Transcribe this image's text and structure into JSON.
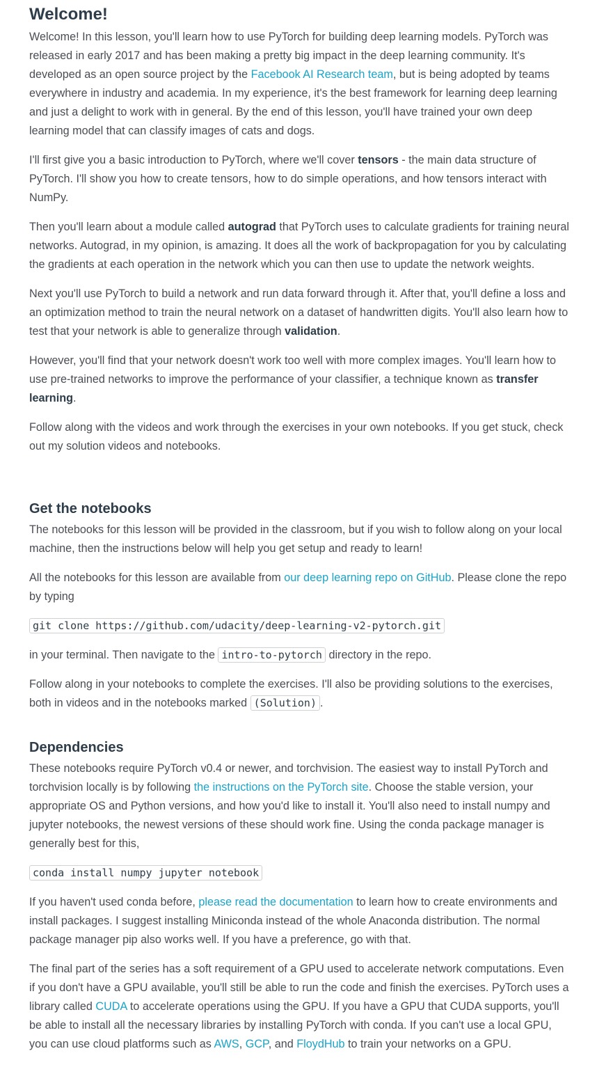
{
  "welcome": {
    "title": "Welcome!",
    "p1": {
      "a": "Welcome! In this lesson, you'll learn how to use PyTorch for building deep learning models. PyTorch was released in early 2017 and has been making a pretty big impact in the deep learning community. It's developed as an open source project by the ",
      "link": "Facebook AI Research team",
      "b": ", but is being adopted by teams everywhere in industry and academia. In my experience, it's the best framework for learning deep learning and just a delight to work with in general. By the end of this lesson, you'll have trained your own deep learning model that can classify images of cats and dogs."
    },
    "p2": {
      "a": "I'll first give you a basic introduction to PyTorch, where we'll cover ",
      "bold": "tensors",
      "b": " - the main data structure of PyTorch. I'll show you how to create tensors, how to do simple operations, and how tensors interact with NumPy."
    },
    "p3": {
      "a": "Then you'll learn about a module called ",
      "bold": "autograd",
      "b": " that PyTorch uses to calculate gradients for training neural networks. Autograd, in my opinion, is amazing. It does all the work of backpropagation for you by calculating the gradients at each operation in the network which you can then use to update the network weights."
    },
    "p4": {
      "a": "Next you'll use PyTorch to build a network and run data forward through it. After that, you'll define a loss and an optimization method to train the neural network on a dataset of handwritten digits. You'll also learn how to test that your network is able to generalize through ",
      "bold": "validation",
      "b": "."
    },
    "p5": {
      "a": "However, you'll find that your network doesn't work too well with more complex images. You'll learn how to use pre-trained networks to improve the performance of your classifier, a technique known as ",
      "bold": "transfer learning",
      "b": "."
    },
    "p6": "Follow along with the videos and work through the exercises in your own notebooks. If you get stuck, check out my solution videos and notebooks."
  },
  "notebooks": {
    "title": "Get the notebooks",
    "p1": "The notebooks for this lesson will be provided in the classroom, but if you wish to follow along on your local machine, then the instructions below will help you get setup and ready to learn!",
    "p2": {
      "a": "All the notebooks for this lesson are available from ",
      "link": "our deep learning repo on GitHub",
      "b": ". Please clone the repo by typing"
    },
    "clone_cmd": "git clone https://github.com/udacity/deep-learning-v2-pytorch.git",
    "p3": {
      "a": "in your terminal. Then navigate to the ",
      "code": "intro-to-pytorch",
      "b": " directory in the repo."
    },
    "p4": {
      "a": "Follow along in your notebooks to complete the exercises. I'll also be providing solutions to the exercises, both in videos and in the notebooks marked ",
      "code": "(Solution)",
      "b": "."
    }
  },
  "dependencies": {
    "title": "Dependencies",
    "p1": {
      "a": "These notebooks require PyTorch v0.4 or newer, and torchvision. The easiest way to install PyTorch and torchvision locally is by following ",
      "link": "the instructions on the PyTorch site",
      "b": ". Choose the stable version, your appropriate OS and Python versions, and how you'd like to install it. You'll also need to install numpy and jupyter notebooks, the newest versions of these should work fine. Using the conda package manager is generally best for this,"
    },
    "install_cmd": "conda install numpy jupyter notebook",
    "p2": {
      "a": "If you haven't used conda before, ",
      "link": "please read the documentation",
      "b": " to learn how to create environments and install packages. I suggest installing Miniconda instead of the whole Anaconda distribution. The normal package manager pip also works well. If you have a preference, go with that."
    },
    "p3": {
      "a": "The final part of the series has a soft requirement of a GPU used to accelerate network computations. Even if you don't have a GPU available, you'll still be able to run the code and finish the exercises. PyTorch uses a library called ",
      "link_cuda": "CUDA",
      "b": " to accelerate operations using the GPU. If you have a GPU that CUDA supports, you'll be able to install all the necessary libraries by installing PyTorch with conda. If you can't use a local GPU, you can use cloud platforms such as ",
      "link_aws": "AWS",
      "c": ", ",
      "link_gcp": "GCP",
      "d": ", and ",
      "link_floydhub": "FloydHub",
      "e": " to train your networks on a GPU."
    }
  },
  "colors": {
    "heading": "#2e3d49",
    "body_text": "#4a4d53",
    "link": "#1aa4c8",
    "code_border": "#cfd2d4"
  }
}
